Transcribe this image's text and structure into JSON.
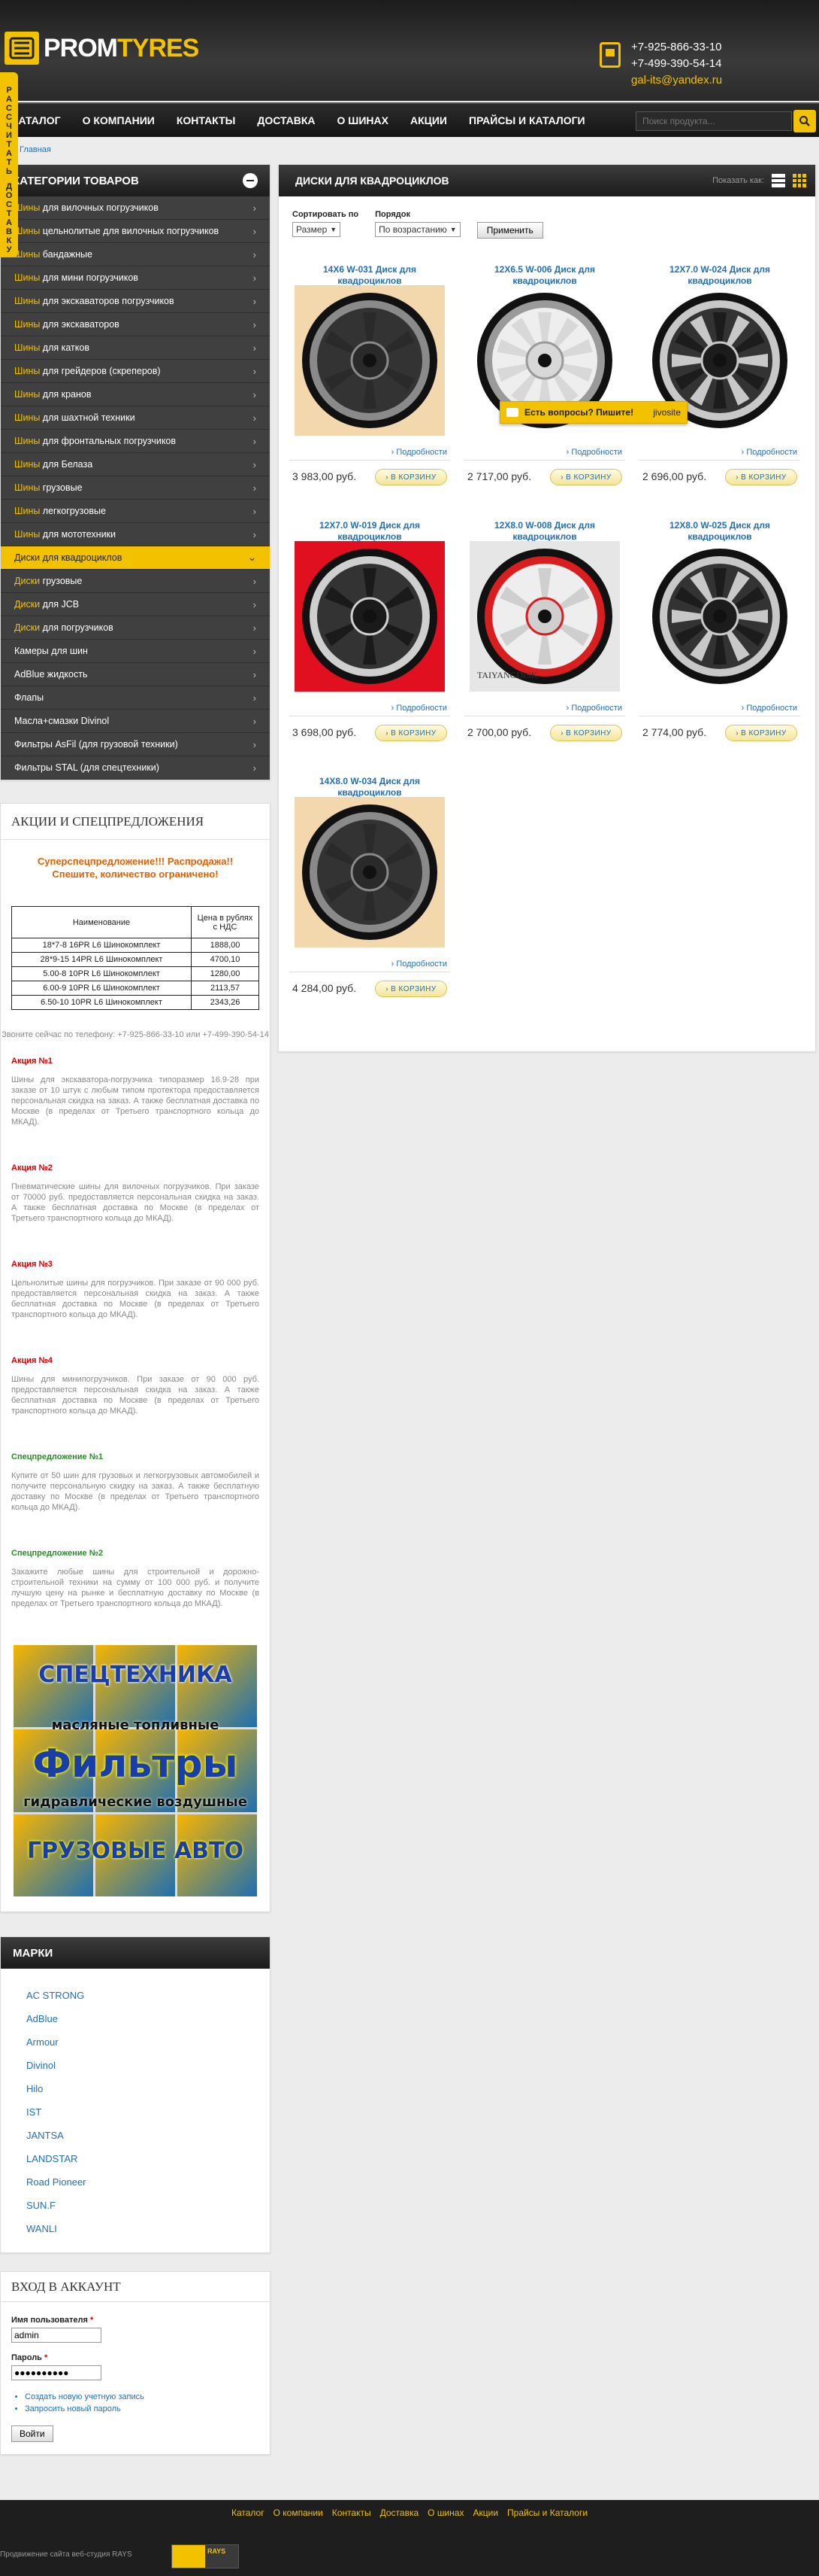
{
  "brand": {
    "name_a": "PROM",
    "name_b": "TYRES"
  },
  "contacts": {
    "phone1": "+7-925-866-33-10",
    "phone2": "+7-499-390-54-14",
    "email": "gal-its@yandex.ru"
  },
  "delivery_tab": [
    "Р",
    "А",
    "С",
    "С",
    "Ч",
    "И",
    "Т",
    "А",
    "Т",
    "Ь",
    "",
    "Д",
    "О",
    "С",
    "Т",
    "А",
    "В",
    "К",
    "У"
  ],
  "nav": [
    "КАТАЛОГ",
    "О КОМПАНИИ",
    "КОНТАКТЫ",
    "ДОСТАВКА",
    "О ШИНАХ",
    "АКЦИИ",
    "ПРАЙСЫ И КАТАЛОГИ"
  ],
  "search": {
    "placeholder": "Поиск продукта..."
  },
  "breadcrumb": "Главная",
  "categories": {
    "title": "КАТЕГОРИИ ТОВАРОВ",
    "items": [
      {
        "k": "Шины",
        "rest": " для вилочных погрузчиков"
      },
      {
        "k": "Шины",
        "rest": " цельнолитые для вилочных погрузчиков"
      },
      {
        "k": "Шины",
        "rest": " бандажные"
      },
      {
        "k": "Шины",
        "rest": " для мини погрузчиков"
      },
      {
        "k": "Шины",
        "rest": " для экскаваторов погрузчиков"
      },
      {
        "k": "Шины",
        "rest": " для экскаваторов"
      },
      {
        "k": "Шины",
        "rest": " для катков"
      },
      {
        "k": "Шины",
        "rest": " для грейдеров (скреперов)"
      },
      {
        "k": "Шины",
        "rest": " для кранов"
      },
      {
        "k": "Шины",
        "rest": " для шахтной техники"
      },
      {
        "k": "Шины",
        "rest": " для фронтальных погрузчиков"
      },
      {
        "k": "Шины",
        "rest": " для Белаза"
      },
      {
        "k": "Шины",
        "rest": " грузовые"
      },
      {
        "k": "Шины",
        "rest": " легкогрузовые"
      },
      {
        "k": "Шины",
        "rest": " для мототехники"
      },
      {
        "k": "",
        "rest": "Диски для квадроциклов",
        "active": true
      },
      {
        "k": "Диски",
        "rest": " грузовые"
      },
      {
        "k": "Диски",
        "rest": " для JCB"
      },
      {
        "k": "Диски",
        "rest": " для погрузчиков"
      },
      {
        "k": "",
        "rest": "Камеры для шин"
      },
      {
        "k": "",
        "rest": "AdBlue жидкость"
      },
      {
        "k": "",
        "rest": "Флапы"
      },
      {
        "k": "",
        "rest": "Масла+смазки Divinol"
      },
      {
        "k": "",
        "rest": "Фильтры AsFil (для грузовой техники)"
      },
      {
        "k": "",
        "rest": "Фильтры STAL (для спецтехники)"
      }
    ]
  },
  "promo": {
    "title": "АКЦИИ И СПЕЦПРЕДЛОЖЕНИЯ",
    "super": "Суперспецпредложение!!! Распродажа!! Спешите, количество ограничено!",
    "table_headers": [
      "Наименование",
      "Цена в рублях с НДС"
    ],
    "table_rows": [
      [
        "18*7-8 16PR L6 Шинокомплект",
        "1888,00"
      ],
      [
        "28*9-15 14PR L6 Шинокомплект",
        "4700,10"
      ],
      [
        "5.00-8 10PR L6 Шинокомплект",
        "1280,00"
      ],
      [
        "6.00-9 10PR L6 Шинокомплект",
        "2113,57"
      ],
      [
        "6.50-10 10PR L6 Шинокомплект",
        "2343,26"
      ]
    ],
    "call": "Звоните сейчас по телефону: +7-925-866-33-10 или +7-499-390-54-14",
    "actions": [
      {
        "title": "Акция №1",
        "body": "Шины для экскаватора-погрузчика типоразмер 16.9-28 при заказе от 10 штук с любым типом протектора предоставляется персональная скидка на заказ. А также бесплатная доставка по Москве (в пределах от Третьего транспортного кольца до МКАД).",
        "green": false
      },
      {
        "title": "Акция №2",
        "body": "Пневматические шины для вилочных погрузчиков. При заказе от 70000 руб. предоставляется персональная скидка на заказ. А также бесплатная доставка по Москве (в пределах от Третьего транспортного кольца до МКАД).",
        "green": false
      },
      {
        "title": "Акция №3",
        "body": "Цельнолитые шины для погрузчиков. При заказе от 90 000 руб. предоставляется персональная скидка на заказ. А также бесплатная доставка по Москве (в пределах от Третьего транспортного кольца до МКАД).",
        "green": false
      },
      {
        "title": "Акция №4",
        "body": "Шины для минипогрузчиков. При заказе от 90 000 руб. предоставляется персональная скидка на заказ. А также бесплатная доставка по Москве (в пределах от Третьего транспортного кольца до МКАД).",
        "green": false
      },
      {
        "title": "Спецпредложение №1",
        "body": "Купите от 50 шин для грузовых и легкогрузовых автомобилей и получите персональную скидку на заказ. А также бесплатную доставку по Москве (в пределах от Третьего транспортного кольца до МКАД).",
        "green": true
      },
      {
        "title": "Спецпредложение №2",
        "body": "Закажите любые шины для строительной и дорожно-строительной техники на сумму от 100 000 руб. и получите лучшую цену на рынке и бесплатную доставку по Москве (в пределах от Третьего транспортного кольца до МКАД).",
        "green": true
      }
    ],
    "banner": {
      "line1": "СПЕЦТЕХНИКА",
      "line2": "масляные     топливные",
      "line3": "Фильтры",
      "line4": "гидравлические   воздушные",
      "line5": "ГРУЗОВЫЕ АВТО"
    }
  },
  "brands": {
    "title": "МАРКИ",
    "items": [
      "AC STRONG",
      "AdBlue",
      "Armour",
      "Divinol",
      "Hilo",
      "IST",
      "JANTSA",
      "LANDSTAR",
      "Road Pioneer",
      "SUN.F",
      "WANLI"
    ]
  },
  "login": {
    "title": "ВХОД В АККАУНТ",
    "user_label": "Имя пользователя",
    "user_value": "admin",
    "pass_label": "Пароль",
    "pass_value": "●●●●●●●●●●",
    "req": "*",
    "links": [
      "Создать новую учетную запись",
      "Запросить новый пароль"
    ],
    "submit": "Войти"
  },
  "main": {
    "title": "ДИСКИ ДЛЯ КВАДРОЦИКЛОВ",
    "view_label": "Показать как:",
    "sort_label": "Сортировать по",
    "sort_value": "Размер",
    "order_label": "Порядок",
    "order_value": "По возрастанию",
    "apply": "Применить",
    "details": "Подробности",
    "cart": "В КОРЗИНУ",
    "products": [
      {
        "name": "14X6 W-031 Диск для квадроциклов",
        "price": "3 983,00 руб.",
        "style": "black",
        "bg": "#f3d7ad"
      },
      {
        "name": "12X6.5 W-006 Диск для квадроциклов",
        "price": "2 717,00 руб.",
        "style": "silver",
        "bg": "#ffffff"
      },
      {
        "name": "12X7.0 W-024 Диск для квадроциклов",
        "price": "2 696,00 руб.",
        "style": "blackcut",
        "bg": "#ffffff"
      },
      {
        "name": "12X7.0 W-019 Диск для квадроциклов",
        "price": "3 698,00 руб.",
        "style": "red",
        "bg": "#e01020"
      },
      {
        "name": "12X8.0 W-008 Диск для квадроциклов",
        "price": "2 700,00 руб.",
        "style": "silverred",
        "bg": "#e6e6e6"
      },
      {
        "name": "12X8.0 W-025 Диск для квадроциклов",
        "price": "2 774,00 руб.",
        "style": "blackcut",
        "bg": "#ffffff"
      },
      {
        "name": "14X8.0 W-034 Диск для квадроциклов",
        "price": "4 284,00 руб.",
        "style": "black",
        "bg": "#f3d7ad"
      }
    ],
    "watermark": "TAIYANGDISK"
  },
  "chat": {
    "text": "Есть вопросы? Пишите!",
    "brand": "jivosite"
  },
  "footer": {
    "links": [
      "Каталог",
      "О компании",
      "Контакты",
      "Доставка",
      "О шинах",
      "Акции",
      "Прайсы и Каталоги"
    ],
    "copy": "Продвижение сайта веб-студия RAYS",
    "meter": "RAYS"
  },
  "colors": {
    "accent": "#f2c100",
    "dark": "#1e1e1e",
    "link": "#246fb4"
  }
}
